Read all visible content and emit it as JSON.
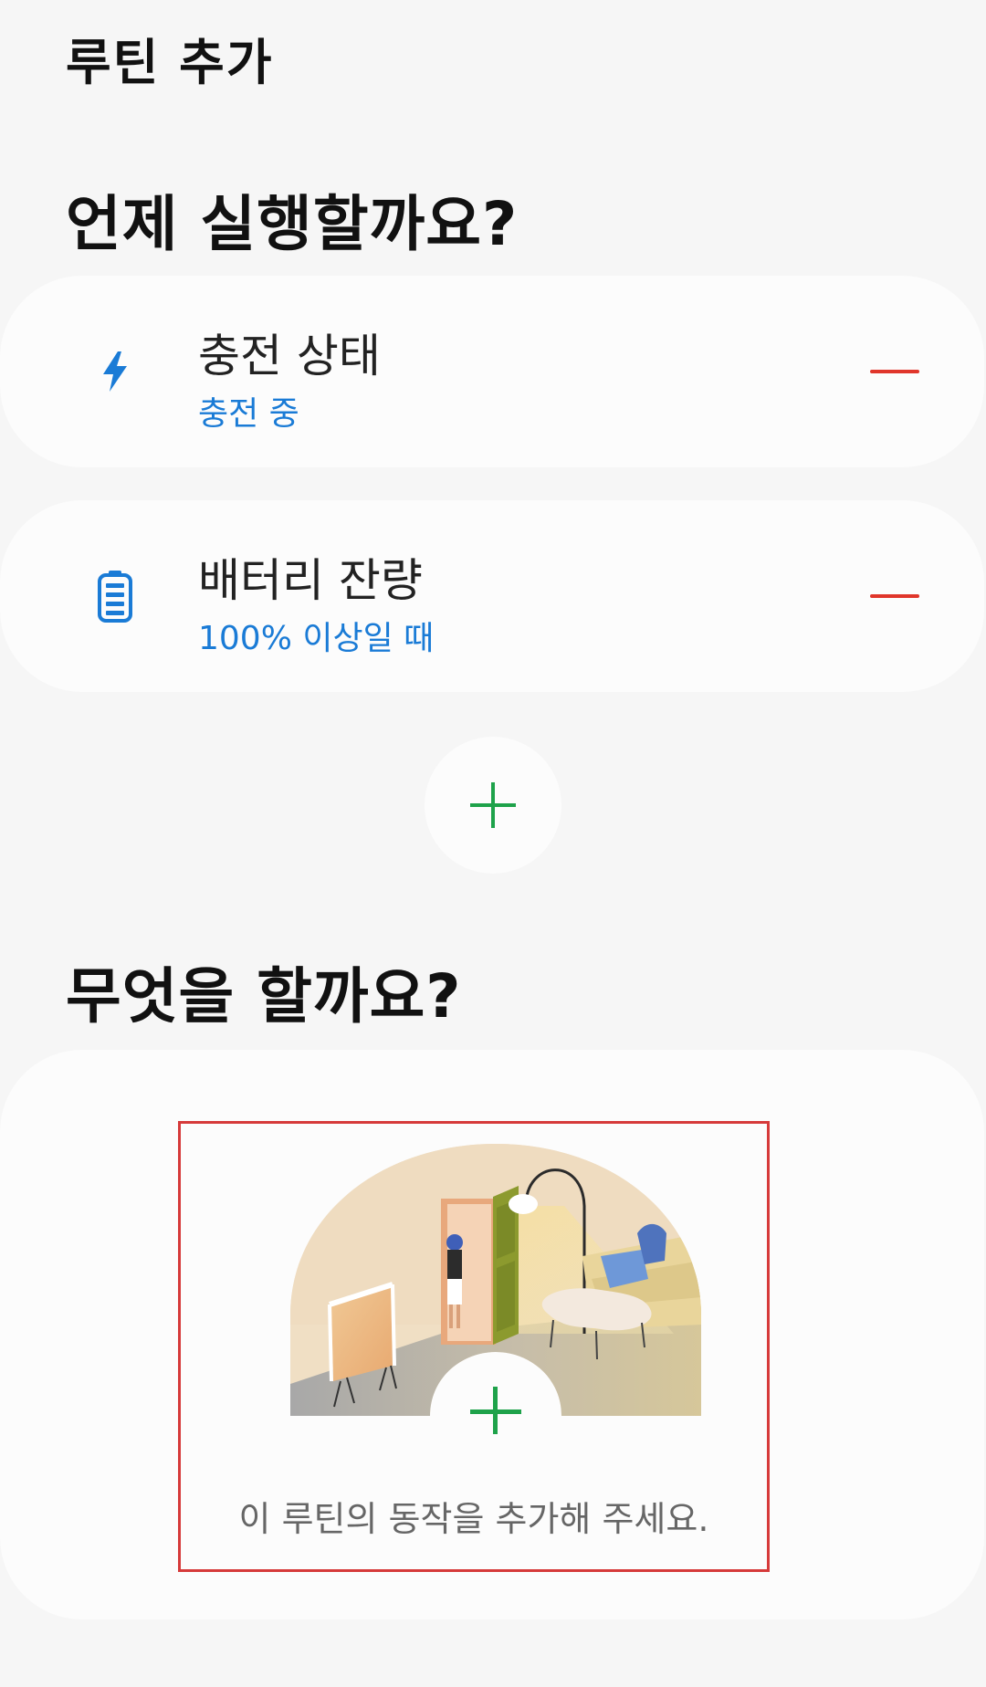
{
  "header": {
    "title": "루틴 추가"
  },
  "when_section": {
    "title": "언제 실행할까요?",
    "conditions": [
      {
        "icon": "lightning-icon",
        "label": "충전 상태",
        "value": "충전 중"
      },
      {
        "icon": "battery-icon",
        "label": "배터리 잔량",
        "value": "100% 이상일 때"
      }
    ]
  },
  "what_section": {
    "title": "무엇을 할까요?",
    "hint": "이 루틴의 동작을 추가해 주세요."
  },
  "colors": {
    "accent_blue": "#1a7bd6",
    "remove_red": "#e0362b",
    "add_green": "#1ea24a",
    "background": "#f6f6f6",
    "card": "#fcfcfc"
  }
}
